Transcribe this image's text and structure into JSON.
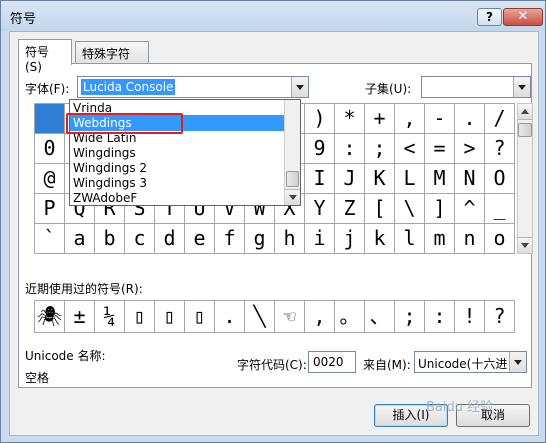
{
  "window": {
    "title": "符号",
    "help_label": "?",
    "close_label": "✕"
  },
  "tabs": [
    {
      "label": "符号(S)"
    },
    {
      "label": "特殊字符(P)"
    }
  ],
  "font": {
    "label": "字体(F):",
    "value": "Lucida Console"
  },
  "subset": {
    "label": "子集(U):",
    "value": ""
  },
  "font_dropdown": {
    "items": [
      "Vrinda",
      "Webdings",
      "Wide Latin",
      "Wingdings",
      "Wingdings 2",
      "Wingdings 3",
      "ZWAdobeF"
    ],
    "selected": "Webdings"
  },
  "symbol_grid": {
    "rows": [
      [
        "",
        "",
        "",
        "",
        "",
        "",
        "",
        "",
        "",
        ")",
        "*",
        "+",
        ",",
        "-",
        ".",
        "/"
      ],
      [
        "0",
        "",
        "",
        "",
        "",
        "",
        "",
        "",
        "",
        "9",
        ":",
        ";",
        "<",
        "=",
        ">",
        "?"
      ],
      [
        "@",
        "",
        "",
        "",
        "",
        "",
        "",
        "",
        "",
        "I",
        "J",
        "K",
        "L",
        "M",
        "N",
        "O"
      ],
      [
        "P",
        "Q",
        "R",
        "S",
        "T",
        "U",
        "V",
        "W",
        "X",
        "Y",
        "Z",
        "[",
        "\\",
        "]",
        "^",
        "_"
      ],
      [
        "`",
        "a",
        "b",
        "c",
        "d",
        "e",
        "f",
        "g",
        "h",
        "i",
        "j",
        "k",
        "l",
        "m",
        "n",
        "o"
      ]
    ]
  },
  "recent": {
    "label": "近期使用过的符号(R):",
    "symbols": [
      "🕷",
      "±",
      "¼",
      "▯",
      "▯",
      "▯",
      ".",
      "╲",
      "☜",
      ",",
      "。",
      "、",
      ";",
      ":",
      "!",
      "?"
    ]
  },
  "unicode": {
    "name_label": "Unicode 名称:",
    "name_value": "空格",
    "code_label": "字符代码(C):",
    "code_value": "0020",
    "from_label": "来自(M):",
    "from_value": "Unicode(十六进"
  },
  "buttons": {
    "insert": "插入(I)",
    "cancel": "取消"
  },
  "watermark": "Baidu 经验"
}
